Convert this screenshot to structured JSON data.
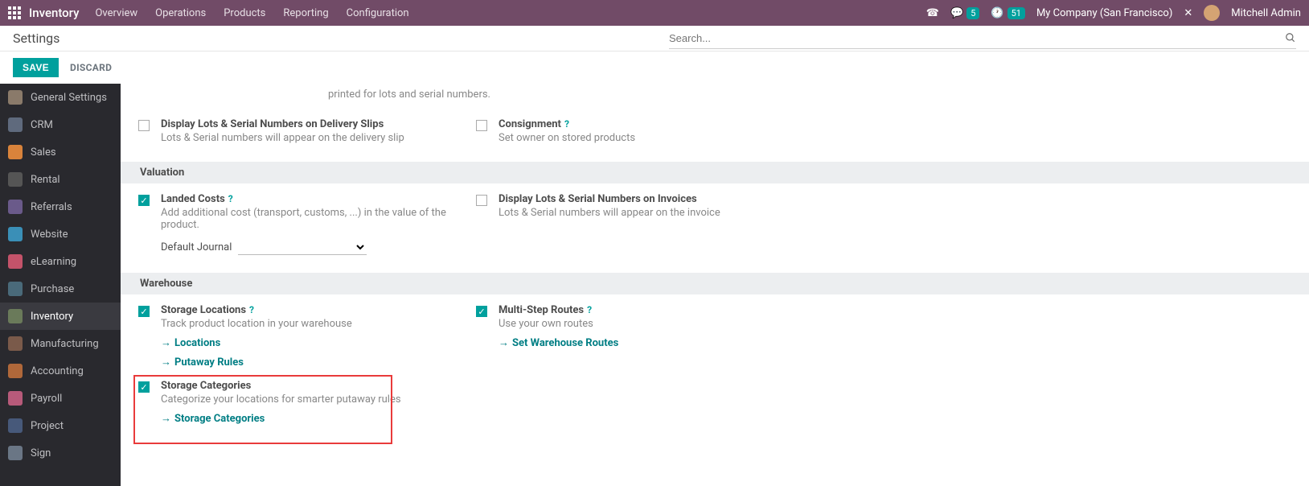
{
  "topbar": {
    "app": "Inventory",
    "nav": [
      "Overview",
      "Operations",
      "Products",
      "Reporting",
      "Configuration"
    ],
    "chat_badge": "5",
    "activity_badge": "51",
    "company": "My Company (San Francisco)",
    "user": "Mitchell Admin"
  },
  "subhead": {
    "title": "Settings",
    "search_placeholder": "Search..."
  },
  "actions": {
    "save": "SAVE",
    "discard": "DISCARD"
  },
  "sidebar": {
    "items": [
      {
        "label": "General Settings",
        "color": "#8a7a6a"
      },
      {
        "label": "CRM",
        "color": "#5f6a7d"
      },
      {
        "label": "Sales",
        "color": "#d9833b"
      },
      {
        "label": "Rental",
        "color": "#555"
      },
      {
        "label": "Referrals",
        "color": "#6a5a8a"
      },
      {
        "label": "Website",
        "color": "#3a8fb7"
      },
      {
        "label": "eLearning",
        "color": "#c4536a"
      },
      {
        "label": "Purchase",
        "color": "#4a6a7a"
      },
      {
        "label": "Inventory",
        "color": "#6a7a5a"
      },
      {
        "label": "Manufacturing",
        "color": "#7a5a4a"
      },
      {
        "label": "Accounting",
        "color": "#b0683a"
      },
      {
        "label": "Payroll",
        "color": "#b75a7a"
      },
      {
        "label": "Project",
        "color": "#47597a"
      },
      {
        "label": "Sign",
        "color": "#6a7685"
      }
    ],
    "active": 8
  },
  "cut_text": "printed for lots and serial numbers.",
  "pre_section": {
    "left": {
      "title": "Display Lots & Serial Numbers on Delivery Slips",
      "desc": "Lots & Serial numbers will appear on the delivery slip"
    },
    "right": {
      "title": "Consignment",
      "desc": "Set owner on stored products"
    }
  },
  "valuation": {
    "heading": "Valuation",
    "left": {
      "title": "Landed Costs",
      "desc": "Add additional cost (transport, customs, ...) in the value of the product.",
      "journal_label": "Default Journal"
    },
    "right": {
      "title": "Display Lots & Serial Numbers on Invoices",
      "desc": "Lots & Serial numbers will appear on the invoice"
    }
  },
  "warehouse": {
    "heading": "Warehouse",
    "storage_loc": {
      "title": "Storage Locations",
      "desc": "Track product location in your warehouse",
      "link1": "Locations",
      "link2": "Putaway Rules"
    },
    "multi_step": {
      "title": "Multi-Step Routes",
      "desc": "Use your own routes",
      "link": "Set Warehouse Routes"
    },
    "storage_cat": {
      "title": "Storage Categories",
      "desc": "Categorize your locations for smarter putaway rules",
      "link": "Storage Categories"
    }
  }
}
